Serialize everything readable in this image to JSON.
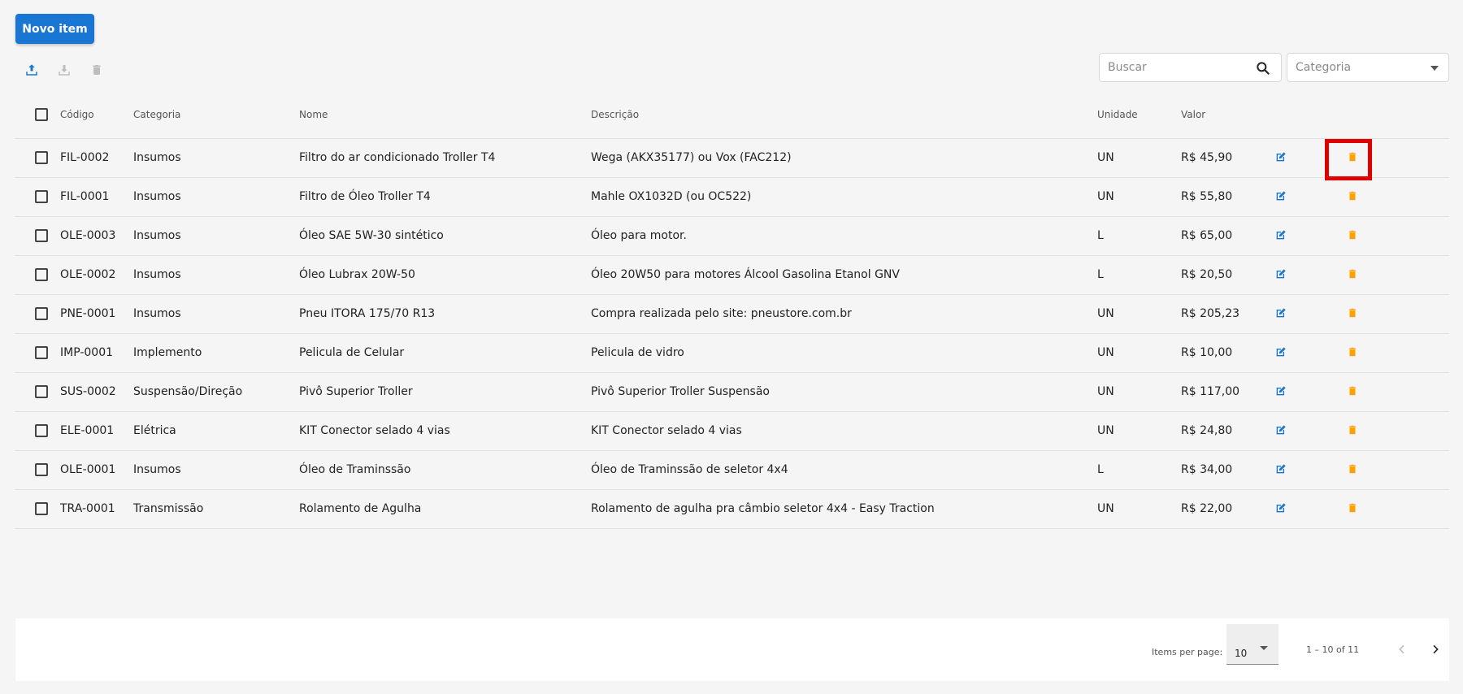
{
  "toolbar": {
    "new_item_label": "Novo item",
    "icons": [
      "upload-icon",
      "download-icon",
      "delete-icon"
    ]
  },
  "search": {
    "placeholder": "Buscar"
  },
  "category_filter": {
    "placeholder": "Categoria"
  },
  "table": {
    "headers": {
      "codigo": "Código",
      "categoria": "Categoria",
      "nome": "Nome",
      "descricao": "Descrição",
      "unidade": "Unidade",
      "valor": "Valor"
    },
    "rows": [
      {
        "codigo": "FIL-0002",
        "categoria": "Insumos",
        "nome": "Filtro do ar condicionado Troller T4",
        "descricao": "Wega (AKX35177) ou Vox (FAC212)",
        "unidade": "UN",
        "valor": "R$ 45,90"
      },
      {
        "codigo": "FIL-0001",
        "categoria": "Insumos",
        "nome": "Filtro de Óleo Troller T4",
        "descricao": "Mahle OX1032D (ou OC522)",
        "unidade": "UN",
        "valor": "R$ 55,80"
      },
      {
        "codigo": "OLE-0003",
        "categoria": "Insumos",
        "nome": "Óleo SAE 5W-30 sintético",
        "descricao": "Óleo para motor.",
        "unidade": "L",
        "valor": "R$ 65,00"
      },
      {
        "codigo": "OLE-0002",
        "categoria": "Insumos",
        "nome": "Óleo Lubrax 20W-50",
        "descricao": "Óleo 20W50 para motores Álcool Gasolina Etanol GNV",
        "unidade": "L",
        "valor": "R$ 20,50"
      },
      {
        "codigo": "PNE-0001",
        "categoria": "Insumos",
        "nome": "Pneu ITORA 175/70 R13",
        "descricao": "Compra realizada pelo site: pneustore.com.br",
        "unidade": "UN",
        "valor": "R$ 205,23"
      },
      {
        "codigo": "IMP-0001",
        "categoria": "Implemento",
        "nome": "Pelicula de Celular",
        "descricao": "Pelicula de vidro",
        "unidade": "UN",
        "valor": "R$ 10,00"
      },
      {
        "codigo": "SUS-0002",
        "categoria": "Suspensão/Direção",
        "nome": "Pivô Superior Troller",
        "descricao": "Pivô Superior Troller Suspensão",
        "unidade": "UN",
        "valor": "R$ 117,00"
      },
      {
        "codigo": "ELE-0001",
        "categoria": "Elétrica",
        "nome": "KIT Conector selado 4 vias",
        "descricao": "KIT Conector selado 4 vias",
        "unidade": "UN",
        "valor": "R$ 24,80"
      },
      {
        "codigo": "OLE-0001",
        "categoria": "Insumos",
        "nome": "Óleo de Traminssão",
        "descricao": "Óleo de Traminssão de seletor 4x4",
        "unidade": "L",
        "valor": "R$ 34,00"
      },
      {
        "codigo": "TRA-0001",
        "categoria": "Transmissão",
        "nome": "Rolamento de Agulha",
        "descricao": "Rolamento de agulha pra câmbio seletor 4x4 - Easy Traction",
        "unidade": "UN",
        "valor": "R$ 22,00"
      }
    ]
  },
  "paginator": {
    "items_per_page_label": "Items per page:",
    "items_per_page_value": "10",
    "range_label": "1 – 10 of 11"
  },
  "colors": {
    "primary": "#1976d2",
    "edit_icon": "#1976d2",
    "delete_icon": "#ffa000",
    "highlight": "#e00000"
  }
}
